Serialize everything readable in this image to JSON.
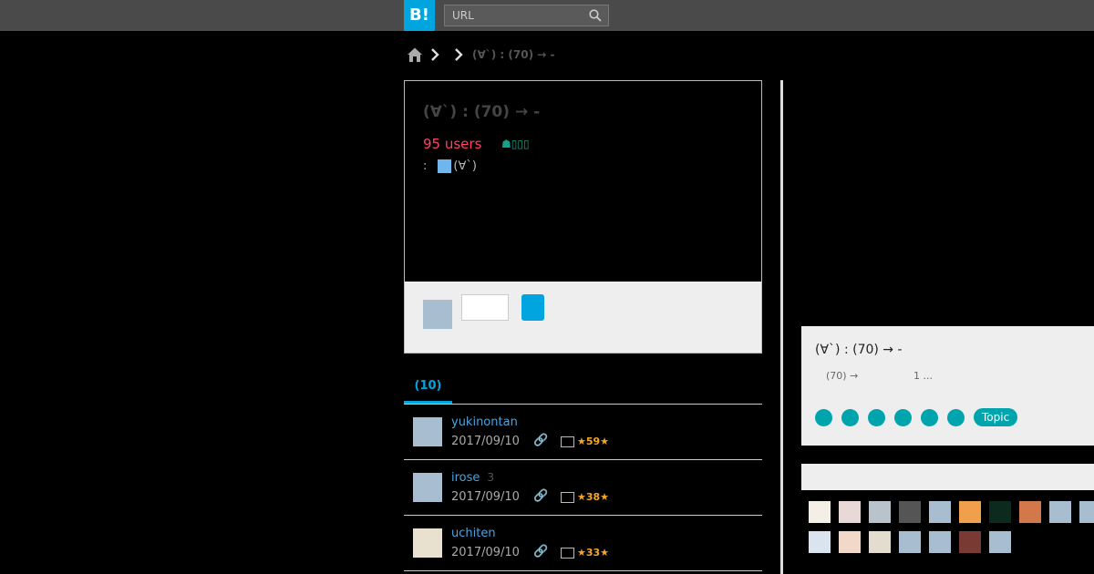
{
  "header": {
    "logo_text": "B!",
    "search_placeholder": "URL"
  },
  "breadcrumb": {
    "current": "(∀`) :  (70) →  -"
  },
  "entry": {
    "title": "(∀`) :  (70) →  -",
    "users": "95 users",
    "turtle_label": "☗▯▯▯",
    "via_prefix": ":",
    "via_site": "(∀`)"
  },
  "tabs": {
    "comments_label": "(10)"
  },
  "bookmarks": [
    {
      "user": "yukinontan",
      "count": "",
      "date": "2017/09/10",
      "stars": "★59★"
    },
    {
      "user": "irose",
      "count": "3",
      "date": "2017/09/10",
      "stars": "★38★"
    },
    {
      "user": "uchiten",
      "count": "",
      "date": "2017/09/10",
      "stars": "★33★"
    }
  ],
  "related": {
    "title": "(∀`) :  (70) →  -",
    "sub1": "(70) →",
    "sub2": "1 ...",
    "topic_label": "Topic"
  },
  "colors": {
    "accent": "#00a4de",
    "users": "#ff4166",
    "teal": "#00a4ac"
  }
}
